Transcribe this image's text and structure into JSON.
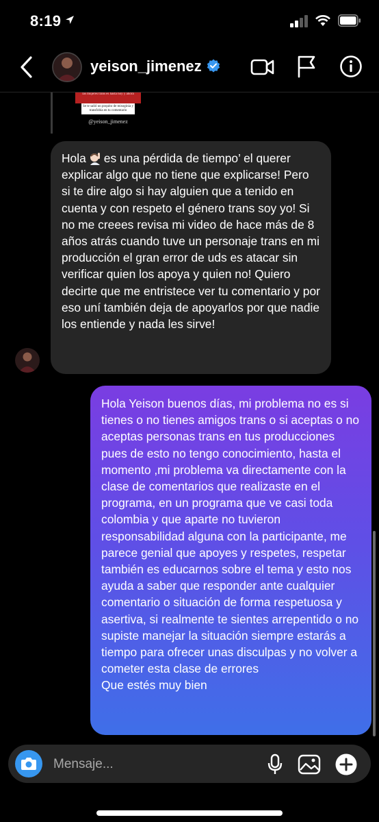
{
  "status": {
    "time": "8:19"
  },
  "header": {
    "username": "yeison_jimenez"
  },
  "shared_post": {
    "red_text": "las mujeres trans es hasta hoy y ahora",
    "white_text": "Se te salió un poquito de misoginia y transfobia en tu comentario",
    "handle": "@yeison_jimenez"
  },
  "messages": {
    "incoming": {
      "lead": "Hola",
      "body": "es una pérdida de tiempo’ el querer explicar algo que no tiene que explicarse! Pero si te dire algo si hay alguien que a tenido en cuenta y con respeto el género trans soy yo! Si no me creees revisa mi video de hace más de 8 años atrás cuando tuve un personaje trans en mi producción el gran error de uds es atacar sin verificar quien los apoya y quien no! Quiero decirte que me entristece ver tu comentario y por eso uní también deja de apoyarlos por que nadie los entiende y nada les sirve!"
    },
    "outgoing": {
      "body": "Hola Yeison buenos días, mi problema no es si tienes o no tienes amigos trans o si aceptas o no aceptas personas trans en tus producciones pues de esto no tengo conocimiento, hasta el momento ,mi problema va directamente con la clase de comentarios que realizaste en el programa, en un programa que ve casi toda colombia y que aparte no tuvieron responsabilidad alguna con la participante, me parece genial que apoyes y respetes, respetar también es  educarnos sobre el tema y esto nos ayuda a saber que responder ante cualquier comentario o situación de forma respetuosa y asertiva, si realmente te sientes arrepentido o no supiste manejar la situación siempre estarás a tiempo para ofrecer unas disculpas y no volver a cometer esta clase de errores",
      "closing": "Que estés muy bien"
    }
  },
  "composer": {
    "placeholder": "Mensaje..."
  },
  "icons": {
    "back": "chevron-left-icon",
    "verified": "verified-badge-icon",
    "video": "video-call-icon",
    "flag": "flag-icon",
    "info": "info-icon",
    "camera": "camera-icon",
    "mic": "microphone-icon",
    "gallery": "gallery-icon",
    "sticker": "add-icon"
  },
  "colors": {
    "background": "#000000",
    "incoming_bubble": "#262626",
    "outgoing_gradient_top": "#7a3de2",
    "outgoing_gradient_bottom": "#3f6fe8",
    "verified": "#3897f0",
    "camera_button": "#3797f0"
  }
}
